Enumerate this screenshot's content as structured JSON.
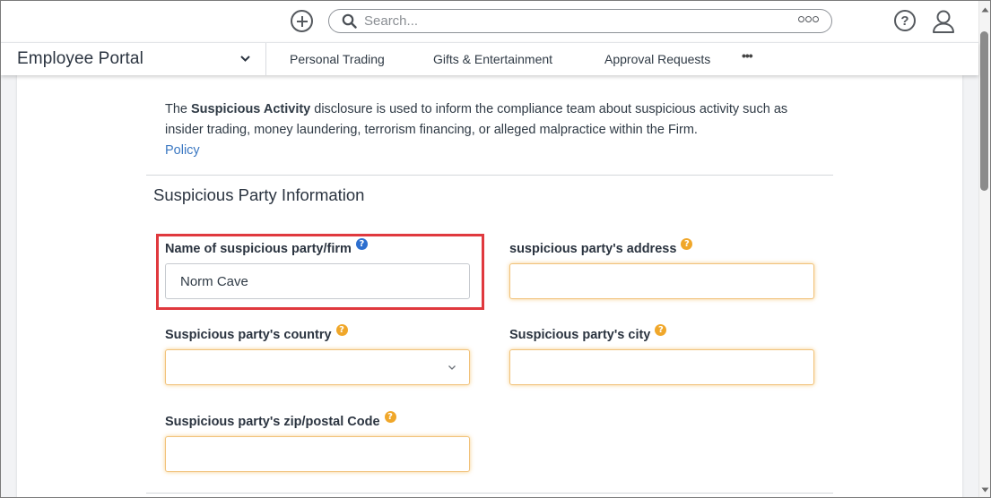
{
  "topbar": {
    "search_placeholder": "Search...",
    "icons": [
      "add-icon",
      "search-icon",
      "more-icon",
      "help-icon",
      "user-icon"
    ]
  },
  "nav": {
    "portal_title": "Employee Portal",
    "items": [
      {
        "label": "Personal Trading"
      },
      {
        "label": "Gifts & Entertainment"
      },
      {
        "label": "Approval Requests"
      }
    ],
    "more_label": "•••"
  },
  "intro": {
    "prefix": "The ",
    "bold": "Suspicious Activity",
    "suffix": " disclosure is used to inform the compliance team about suspicious activity such as insider trading, money laundering, terrorism financing, or alleged malpractice within the Firm.",
    "link": "Policy"
  },
  "section": {
    "title": "Suspicious Party Information"
  },
  "fields": {
    "name": {
      "label": "Name of suspicious party/firm",
      "value": "Norm Cave",
      "help": "?"
    },
    "address": {
      "label": "suspicious party's address",
      "value": "",
      "help": "?"
    },
    "country": {
      "label": "Suspicious party's country",
      "value": "",
      "help": "?"
    },
    "city": {
      "label": "Suspicious party's city",
      "value": "",
      "help": "?"
    },
    "zip": {
      "label": "Suspicious party's zip/postal Code",
      "value": "",
      "help": "?"
    }
  },
  "colors": {
    "accent_link": "#3b78c2",
    "required_glow": "#f0a72a",
    "help_blue": "#2d6fcf",
    "highlight": "#e0393e"
  }
}
